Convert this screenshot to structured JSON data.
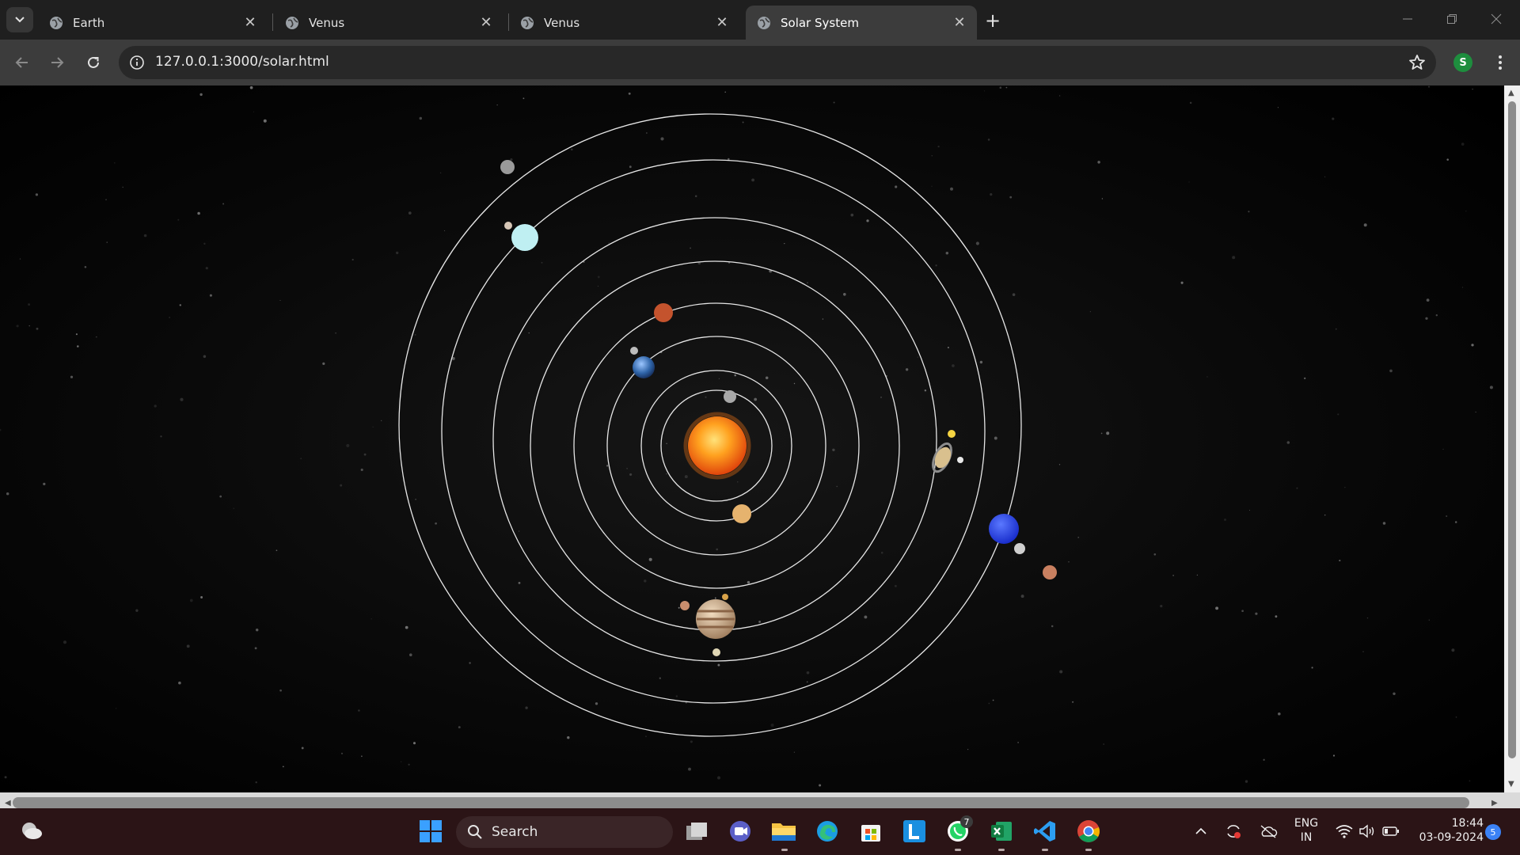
{
  "browser": {
    "tabs": [
      {
        "title": "Earth",
        "active": false
      },
      {
        "title": "Venus",
        "active": false
      },
      {
        "title": "Venus",
        "active": false
      },
      {
        "title": "Solar System",
        "active": true
      }
    ],
    "url": "127.0.0.1:3000/solar.html",
    "profile_initial": "S",
    "icons": {
      "tab_search": "chevron-down-icon",
      "favicon": "globe-icon",
      "close": "close-icon",
      "new_tab": "plus-icon",
      "back": "arrow-left-icon",
      "forward": "arrow-right-icon",
      "reload": "reload-icon",
      "site_info": "info-icon",
      "bookmark": "star-icon",
      "menu": "kebab-menu-icon"
    }
  },
  "scene": {
    "background": "#000000",
    "orbit_color": "#e6e6e6",
    "sun_color": "#ff9a1f",
    "planets": [
      {
        "name": "mercury",
        "color": "#a9a9a9"
      },
      {
        "name": "venus",
        "color": "#e6b36e"
      },
      {
        "name": "earth",
        "color": "#3f78b8"
      },
      {
        "name": "mars",
        "color": "#c4532d"
      },
      {
        "name": "jupiter",
        "color": "#c9a27a"
      },
      {
        "name": "saturn",
        "color": "#d9c08e"
      },
      {
        "name": "uranus",
        "color": "#bfeff2"
      },
      {
        "name": "neptune",
        "color": "#2747ff"
      }
    ]
  },
  "taskbar": {
    "search_label": "Search",
    "language": "ENG",
    "region": "IN",
    "time": "18:44",
    "date": "03-09-2024",
    "notification_count": "5",
    "whatsapp_badge": "7",
    "apps": [
      "windows-start-icon",
      "task-view-icon",
      "meet-icon",
      "file-explorer-icon",
      "edge-icon",
      "store-icon",
      "l-app-icon",
      "whatsapp-icon",
      "excel-icon",
      "vscode-icon",
      "chrome-icon"
    ]
  }
}
